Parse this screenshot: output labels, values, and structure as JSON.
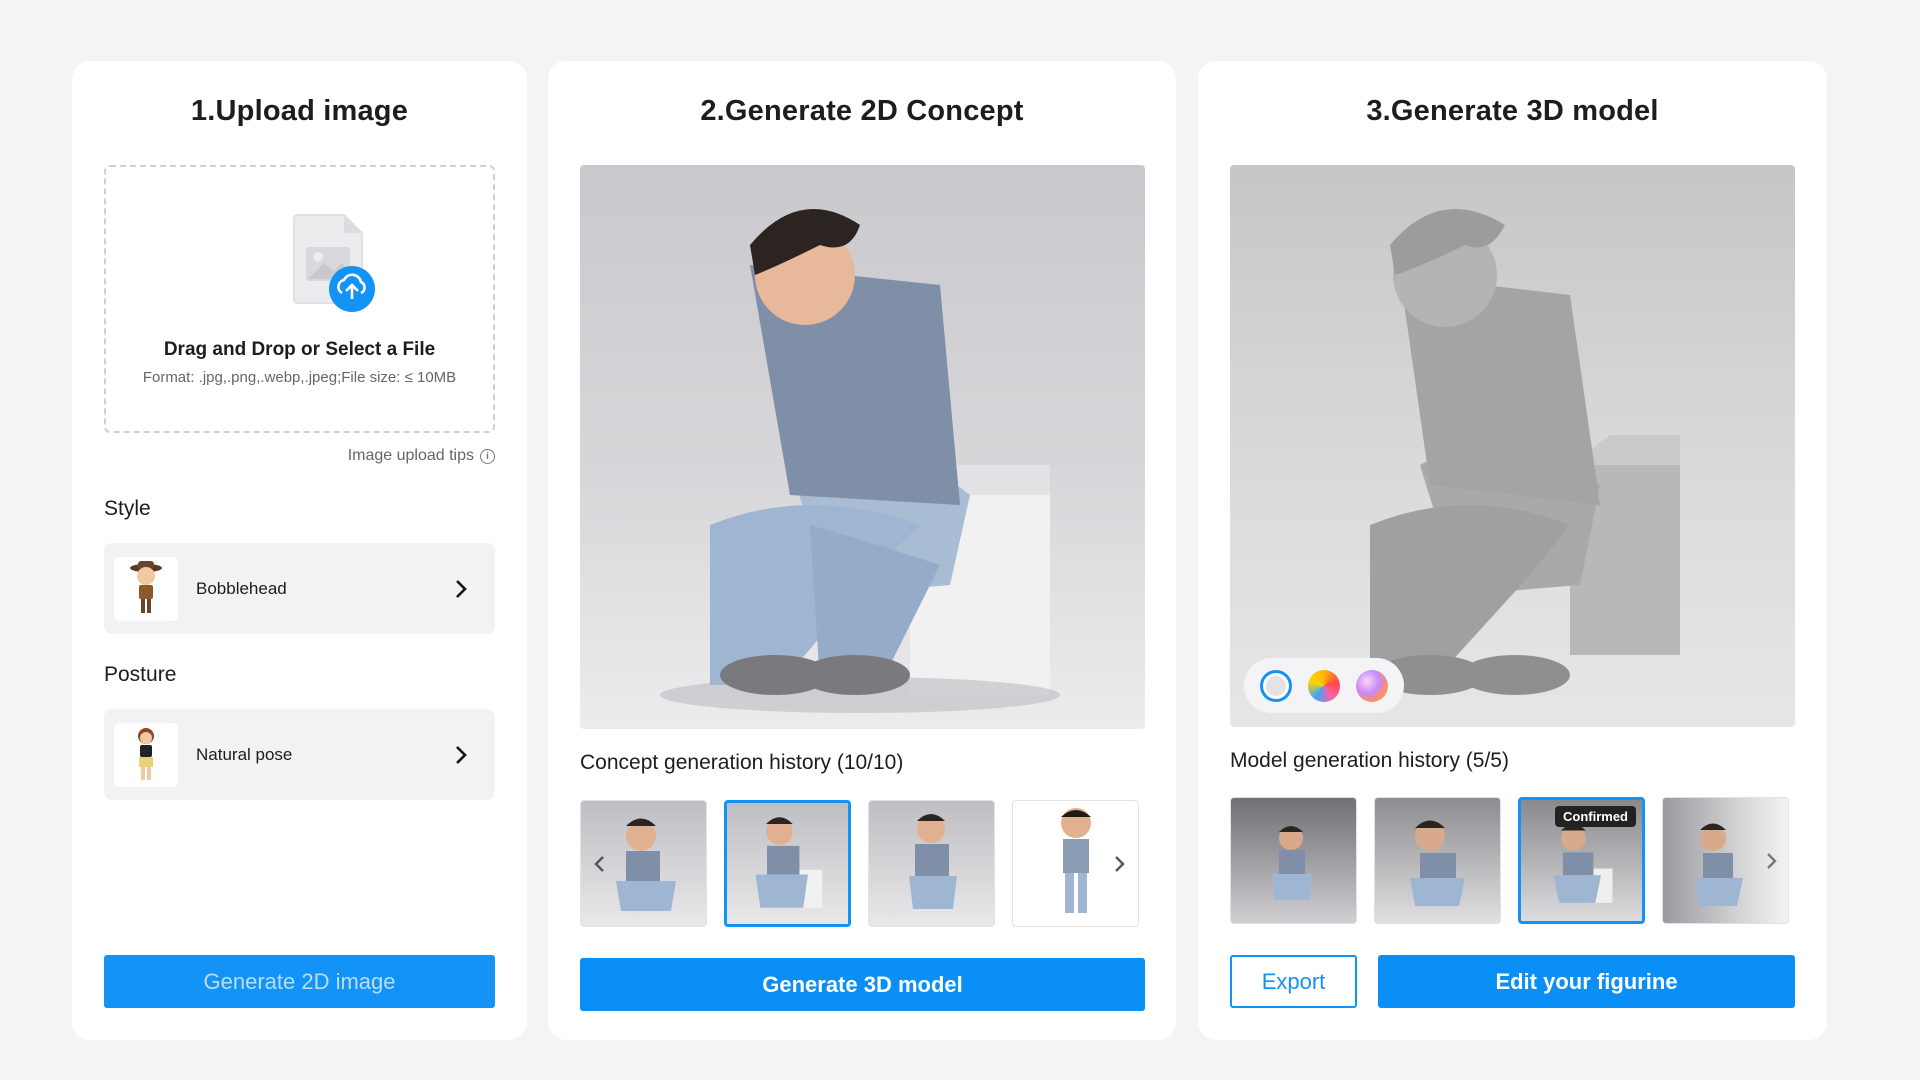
{
  "upload": {
    "title": "1.Upload image",
    "drop_title": "Drag and Drop or Select a File",
    "drop_sub": "Format: .jpg,.png,.webp,.jpeg;File size: ≤ 10MB",
    "tips": "Image upload tips",
    "style_label": "Style",
    "style_value": "Bobblehead",
    "posture_label": "Posture",
    "posture_value": "Natural pose",
    "generate_label": "Generate 2D image"
  },
  "concept": {
    "title": "2.Generate 2D Concept",
    "history_label": "Concept generation history (10/10)",
    "thumbnails": [
      "sitting-pose-1",
      "sitting-pose-2",
      "crouching-pose",
      "standing-pose"
    ],
    "selected_index": 1,
    "generate_label": "Generate 3D model"
  },
  "model": {
    "title": "3.Generate 3D model",
    "history_label": "Model generation history (5/5)",
    "thumbnails": [
      "model-1",
      "model-2",
      "model-3",
      "model-4"
    ],
    "selected_index": 2,
    "confirmed_badge": "Confirmed",
    "render_modes": [
      "plain",
      "multicolor",
      "rainbow"
    ],
    "export_label": "Export",
    "edit_label": "Edit your figurine"
  },
  "colors": {
    "accent": "#1493f7",
    "background": "#f4f4f5"
  }
}
